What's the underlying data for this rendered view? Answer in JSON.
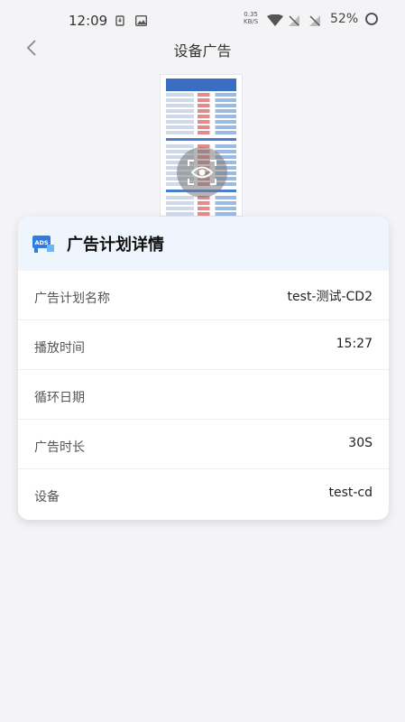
{
  "status_bar": {
    "time": "12:09",
    "net_speed_value": "0.35",
    "net_speed_unit": "KB/S",
    "battery": "52%"
  },
  "header": {
    "title": "设备广告"
  },
  "card": {
    "title": "广告计划详情",
    "badge_text": "ADS",
    "rows": [
      {
        "label": "广告计划名称",
        "value": "test-测试-CD2"
      },
      {
        "label": "播放时间",
        "value": "15:27"
      },
      {
        "label": "循环日期",
        "value": ""
      },
      {
        "label": "广告时长",
        "value": "30S"
      },
      {
        "label": "设备",
        "value": "test-cd"
      }
    ]
  },
  "colors": {
    "card_header_bg": "#eef5fd",
    "badge_blue": "#2f7de1"
  }
}
